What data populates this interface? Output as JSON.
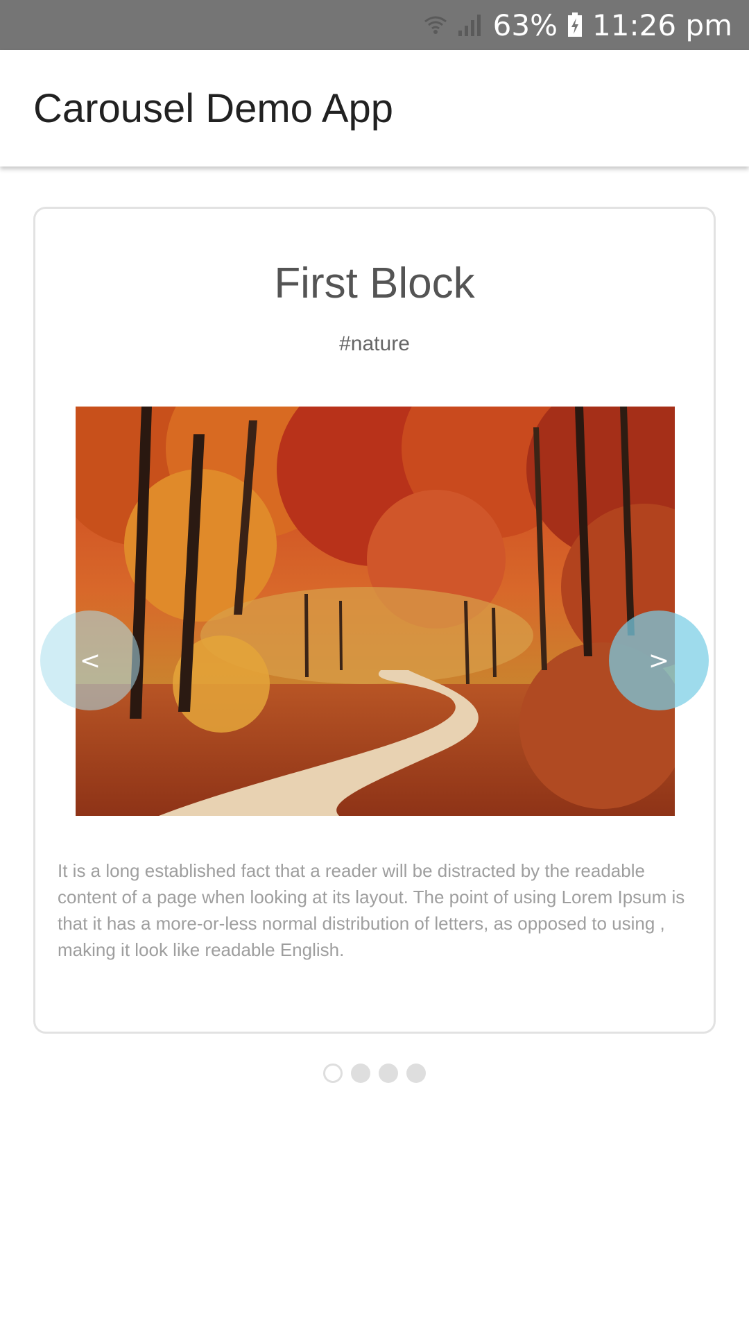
{
  "status_bar": {
    "battery_percent": "63%",
    "time": "11:26 pm",
    "icons": [
      "wifi-icon",
      "signal-icon",
      "battery-charging-icon"
    ]
  },
  "app_bar": {
    "title": "Carousel Demo App"
  },
  "carousel": {
    "slide": {
      "title": "First Block",
      "tag": "#nature",
      "image": "autumn-forest-path",
      "description": "It is a long established fact that a reader will be distracted by the readable content of a page when looking at its layout. The point of using Lorem Ipsum is that it has a more-or-less normal distribution of letters, as opposed to using , making it look like readable English."
    },
    "prev_label": "<",
    "next_label": ">",
    "total_slides": 4,
    "active_index": 0
  },
  "colors": {
    "status_bar_bg": "#757575",
    "nav_button": "#78cde4",
    "card_border": "#e2e2e2",
    "dot_inactive": "#dedede"
  }
}
